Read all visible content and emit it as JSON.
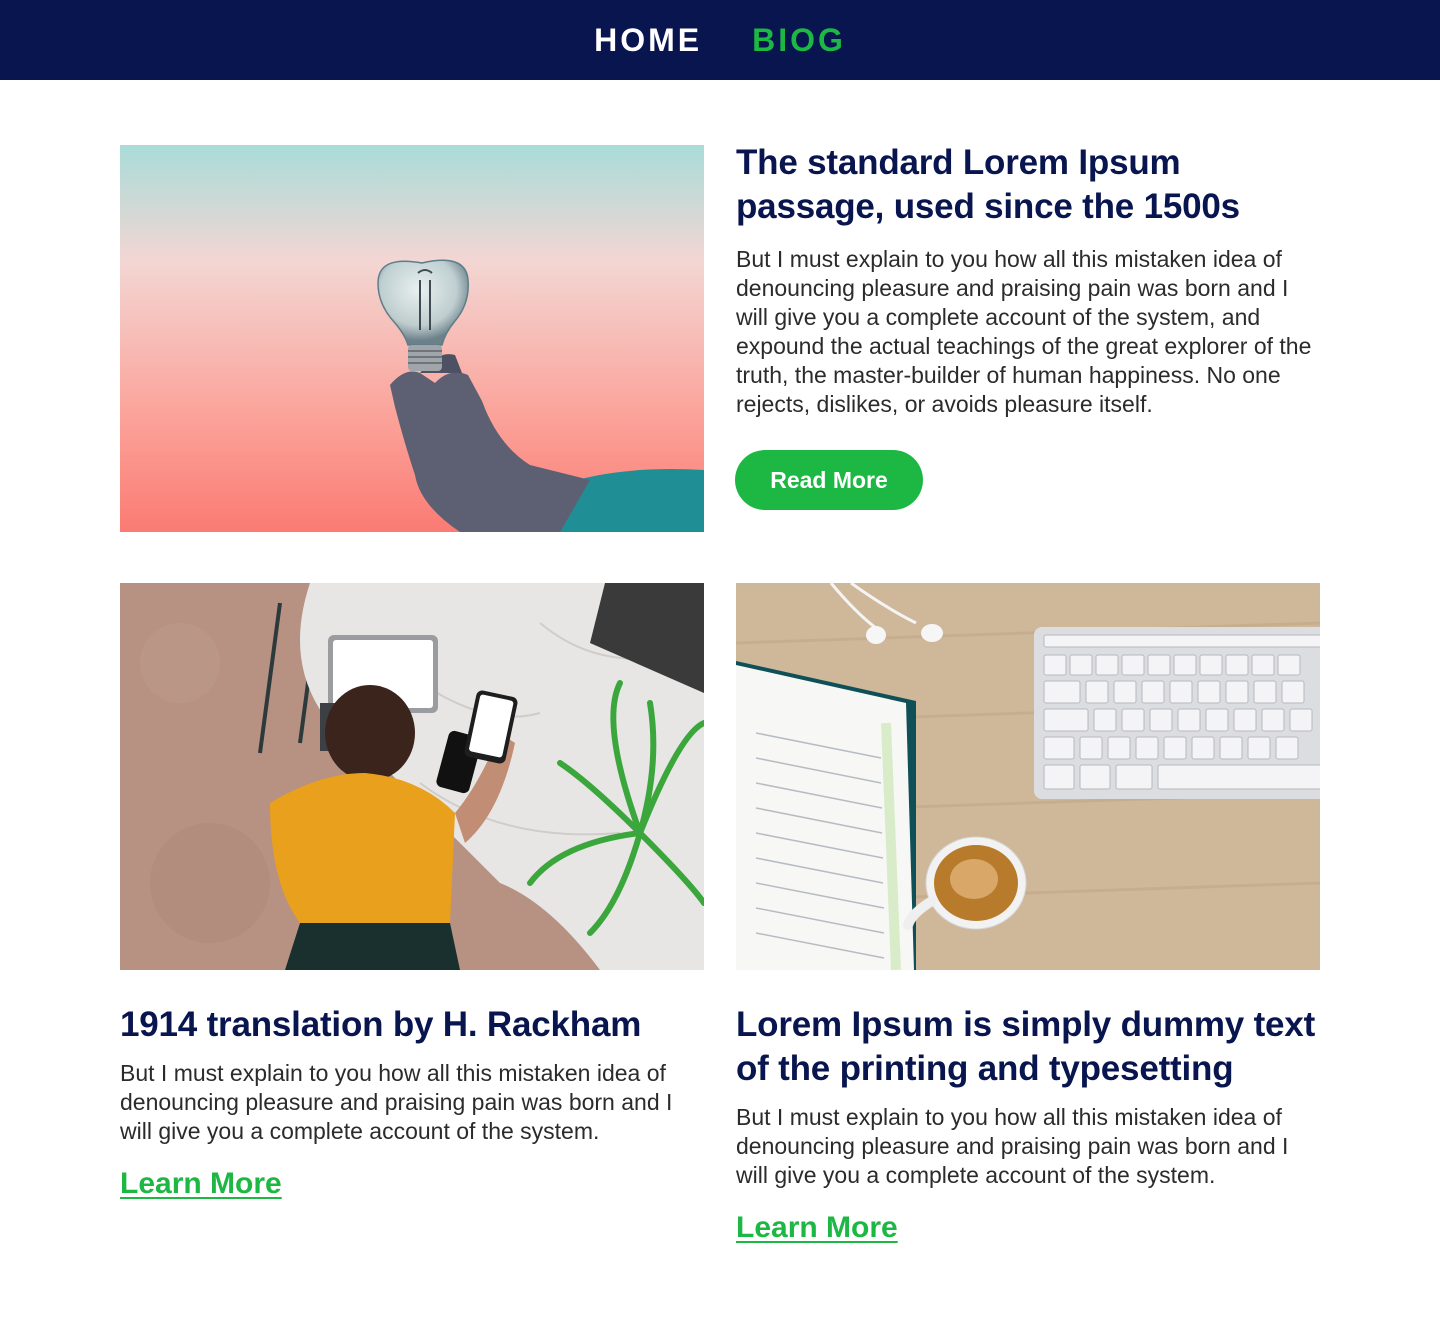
{
  "nav": {
    "home_label": "HOME",
    "blog_label": "BIOG"
  },
  "colors": {
    "navy": "#08154e",
    "green": "#1cb843",
    "text": "#2b2b2b"
  },
  "featured": {
    "image_icon": "lightbulb-photo",
    "title": "The standard Lorem Ipsum passage, used since the 1500s",
    "excerpt": "But I must explain to you how all this mistaken idea of denouncing pleasure and praising pain was born and I will give you a complete account of the system, and expound the actual teachings of the great explorer of the truth, the master-builder of human happiness. No one rejects, dislikes, or avoids pleasure itself.",
    "button_label": "Read More"
  },
  "posts": [
    {
      "image_icon": "woman-at-desk-photo",
      "title": "1914 translation by H. Rackham",
      "excerpt": "But I must explain to you how all this mistaken idea of denouncing pleasure and praising pain was born and I will give you a complete account of the system.",
      "link_label": "Learn More"
    },
    {
      "image_icon": "keyboard-notebook-coffee-photo",
      "title": "Lorem Ipsum is simply dummy text of the printing and typesetting",
      "excerpt": "But I must explain to you how all this mistaken idea of denouncing pleasure and praising pain was born and I will give you a complete account of the system.",
      "link_label": "Learn More"
    }
  ]
}
